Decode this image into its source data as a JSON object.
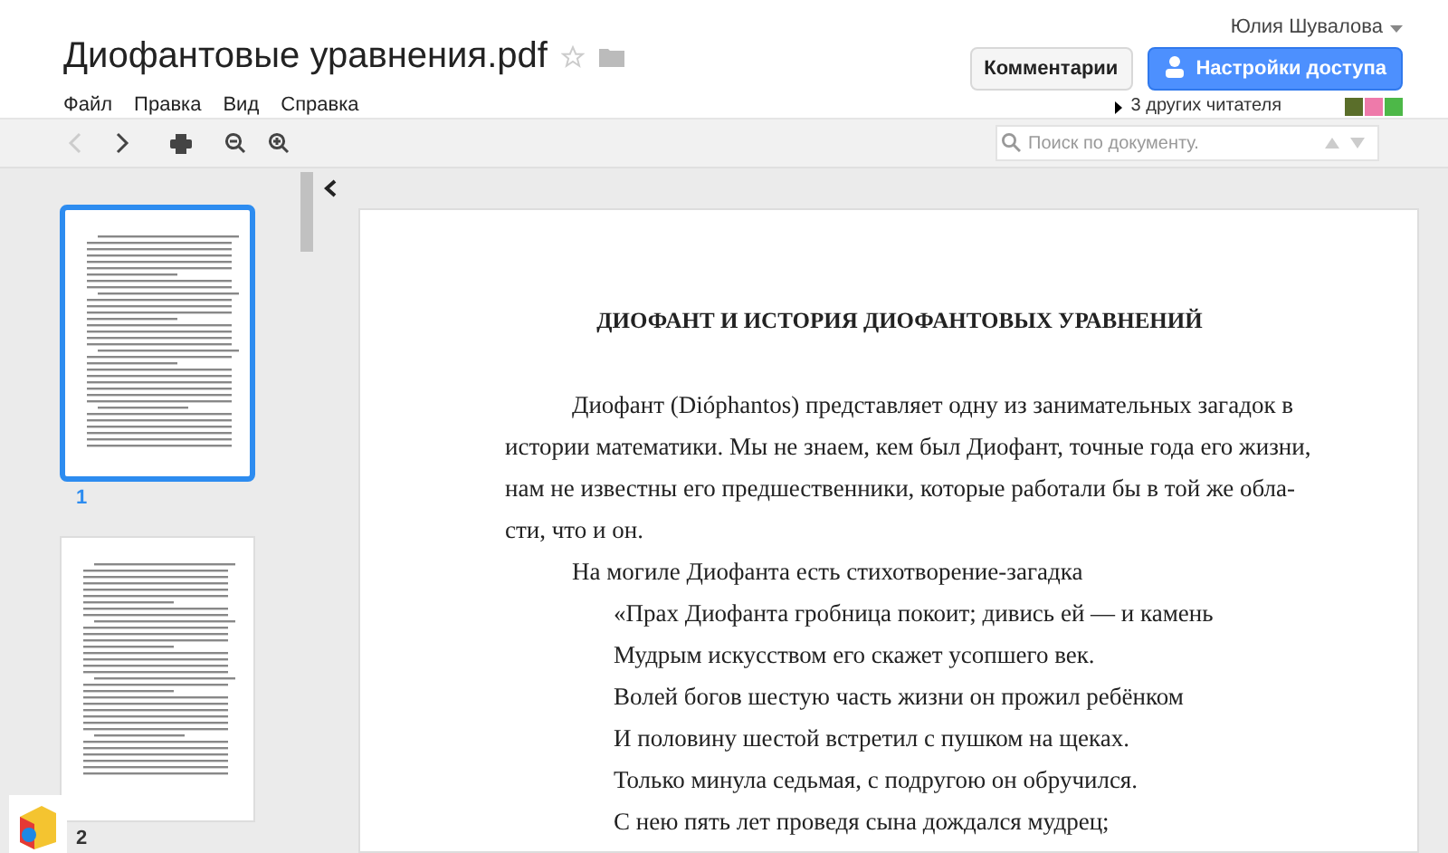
{
  "header": {
    "title": "Диофантовые уравнения.pdf",
    "starred": false,
    "menu": [
      "Файл",
      "Правка",
      "Вид",
      "Справка"
    ],
    "user": "Юлия Шувалова",
    "buttons": [
      {
        "label": "Комментарии",
        "kind": "plain"
      },
      {
        "label": "Настройки доступа",
        "kind": "primary"
      }
    ],
    "viewers": "3 других читателя",
    "viewer_colors": [
      {
        "color": "#5a6e2a"
      },
      {
        "color": "#ee7aaa"
      },
      {
        "color": "#4db848"
      }
    ]
  },
  "toolbar": {
    "back_disabled": true,
    "search": {
      "placeholder": "Поиск по документу."
    }
  },
  "thumbnails": [
    {
      "label": "1",
      "selected": true
    },
    {
      "label": "2",
      "selected": false
    }
  ],
  "document": {
    "heading": "ДИОФАНТ И ИСТОРИЯ ДИОФАНТОВЫХ УРАВНЕНИЙ",
    "lines": [
      {
        "text": "Диофант (Dióphantos) представляет одну из занимательных загадок в",
        "kind": "indent"
      },
      {
        "text": "истории математики. Мы не знаем, кем был Диофант, точные года его жизни,",
        "kind": "plain"
      },
      {
        "text": "нам не известны его предшественники, которые работали бы в той же обла-",
        "kind": "plain"
      },
      {
        "text": "сти, что и он.",
        "kind": "plain"
      },
      {
        "text": "На могиле Диофанта есть стихотворение-загадка",
        "kind": "indent"
      },
      {
        "text": "«Прах Диофанта гробница покоит; дивись ей — и камень",
        "kind": "verse"
      },
      {
        "text": "Мудрым искусством его скажет усопшего век.",
        "kind": "verse"
      },
      {
        "text": "Волей богов шестую часть жизни он прожил ребёнком",
        "kind": "verse"
      },
      {
        "text": "И половину шестой встретил с пушком на щеках.",
        "kind": "verse"
      },
      {
        "text": "Только минула седьмая, с подругою он обручился.",
        "kind": "verse"
      },
      {
        "text": "С нею пять лет проведя сына дождался мудрец;",
        "kind": "verse"
      }
    ]
  }
}
